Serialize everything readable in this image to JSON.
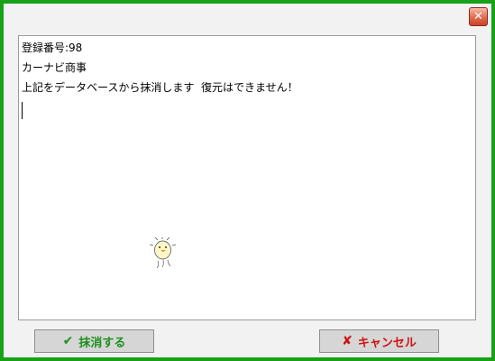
{
  "window": {
    "close_glyph": "✕",
    "border_color": "#17a117"
  },
  "message": {
    "line1": "登録番号:98",
    "line2": "カーナビ商事",
    "line3": "上記をデータベースから抹消します  復元はできません！"
  },
  "buttons": {
    "delete": {
      "icon": "check-icon",
      "glyph": "✔",
      "label": "抹消する",
      "color": "#1f8f1f"
    },
    "cancel": {
      "icon": "cross-icon",
      "glyph": "✘",
      "label": "キャンセル",
      "color": "#d01010"
    }
  },
  "decor": {
    "mascot_icon": "chick-mascot-icon"
  }
}
